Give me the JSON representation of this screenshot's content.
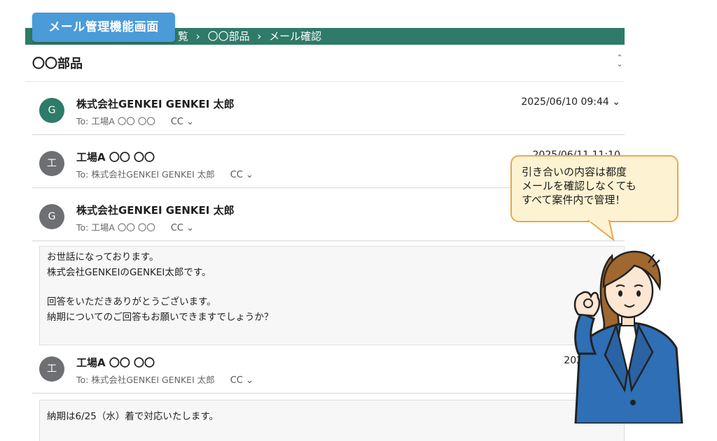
{
  "header": {
    "badge": "メール管理機能画面",
    "breadcrumbs": [
      "覧",
      "›",
      "〇〇部品",
      "›",
      "メール確認"
    ],
    "title": "〇〇部品"
  },
  "mails": [
    {
      "avatar": "G",
      "sender": "株式会社GENKEI GENKEI 太郎",
      "to": "To: 工場A 〇〇 〇〇",
      "cc": "CC ⌄",
      "date": "2025/06/10 09:44 ⌄"
    },
    {
      "avatar": "工",
      "sender": "工場A 〇〇 〇〇",
      "to": "To: 株式会社GENKEI GENKEI 太郎",
      "cc": "CC ⌄",
      "date": "2025/06/11 11:10"
    },
    {
      "avatar": "G",
      "sender": "株式会社GENKEI GENKEI 太郎",
      "to": "To: 工場A 〇〇 〇〇",
      "cc": "CC ⌄",
      "date": ""
    },
    {
      "avatar": "工",
      "sender": "工場A 〇〇 〇〇",
      "to": "To: 株式会社GENKEI GENKEI 太郎",
      "cc": "CC ⌄",
      "date": "2025/06/11"
    }
  ],
  "bodies": {
    "mail3": [
      "お世話になっております。",
      "株式会社GENKEIのGENKEI太郎です。",
      "回答をいただきありがとうございます。",
      "納期についてのご回答もお願いできますでしょうか？"
    ],
    "mail4": [
      "納期は6/25（水）着で対応いたします。"
    ]
  },
  "callout": [
    "引き合いの内容は都度",
    "メールを確認しなくても",
    "すべて案件内で管理！"
  ],
  "colors": {
    "brand_green": "#2f7a69",
    "badge_blue": "#4a9bd8",
    "callout_fill": "#fdf3d2",
    "callout_border": "#e8a850"
  }
}
